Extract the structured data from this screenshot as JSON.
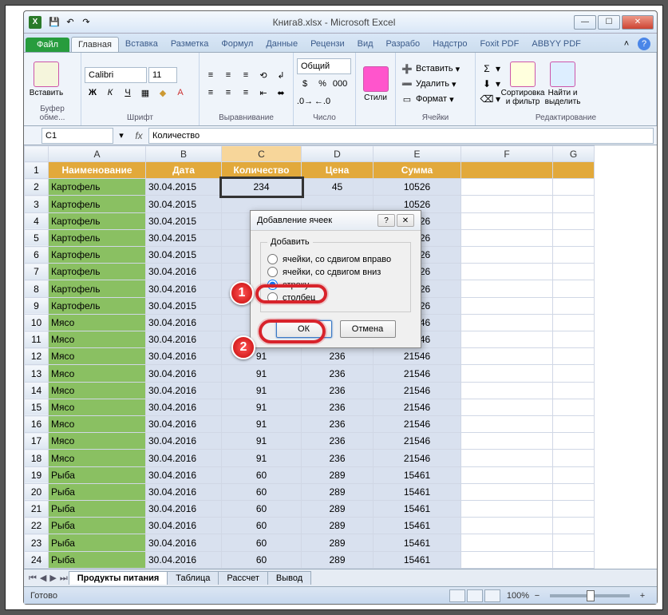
{
  "window_title": "Книга8.xlsx - Microsoft Excel",
  "tabs": {
    "file": "Файл",
    "list": [
      "Главная",
      "Вставка",
      "Разметка",
      "Формул",
      "Данные",
      "Рецензи",
      "Вид",
      "Разрабо",
      "Надстро",
      "Foxit PDF",
      "ABBYY PDF"
    ],
    "active_index": 0
  },
  "ribbon_groups": {
    "clipboard": {
      "paste": "Вставить",
      "label": "Буфер обме..."
    },
    "font": {
      "name": "Calibri",
      "size": "11",
      "label": "Шрифт"
    },
    "alignment": {
      "label": "Выравнивание"
    },
    "number": {
      "format": "Общий",
      "label": "Число"
    },
    "styles": {
      "btn": "Стили"
    },
    "cells": {
      "insert": "Вставить",
      "delete": "Удалить",
      "format": "Формат",
      "label": "Ячейки"
    },
    "editing": {
      "sort": "Сортировка\nи фильтр",
      "find": "Найти и\nвыделить",
      "label": "Редактирование"
    }
  },
  "namebox": "C1",
  "formula": "Количество",
  "columns": [
    "A",
    "B",
    "C",
    "D",
    "E",
    "F",
    "G"
  ],
  "selected_col_index": 2,
  "header_row": [
    "Наименование",
    "Дата",
    "Количество",
    "Цена",
    "Сумма"
  ],
  "rows": [
    [
      "Картофель",
      "30.04.2015",
      "234",
      "45",
      "10526"
    ],
    [
      "Картофель",
      "30.04.2015",
      "",
      "",
      "10526"
    ],
    [
      "Картофель",
      "30.04.2015",
      "",
      "",
      "10526"
    ],
    [
      "Картофель",
      "30.04.2015",
      "",
      "",
      "10526"
    ],
    [
      "Картофель",
      "30.04.2015",
      "",
      "",
      "10526"
    ],
    [
      "Картофель",
      "30.04.2016",
      "",
      "",
      "10526"
    ],
    [
      "Картофель",
      "30.04.2016",
      "",
      "",
      "10526"
    ],
    [
      "Картофель",
      "30.04.2015",
      "",
      "",
      "10526"
    ],
    [
      "Мясо",
      "30.04.2016",
      "",
      "",
      "21546"
    ],
    [
      "Мясо",
      "30.04.2016",
      "",
      "",
      "21546"
    ],
    [
      "Мясо",
      "30.04.2016",
      "91",
      "236",
      "21546"
    ],
    [
      "Мясо",
      "30.04.2016",
      "91",
      "236",
      "21546"
    ],
    [
      "Мясо",
      "30.04.2016",
      "91",
      "236",
      "21546"
    ],
    [
      "Мясо",
      "30.04.2016",
      "91",
      "236",
      "21546"
    ],
    [
      "Мясо",
      "30.04.2016",
      "91",
      "236",
      "21546"
    ],
    [
      "Мясо",
      "30.04.2016",
      "91",
      "236",
      "21546"
    ],
    [
      "Мясо",
      "30.04.2016",
      "91",
      "236",
      "21546"
    ],
    [
      "Рыба",
      "30.04.2016",
      "60",
      "289",
      "15461"
    ],
    [
      "Рыба",
      "30.04.2016",
      "60",
      "289",
      "15461"
    ],
    [
      "Рыба",
      "30.04.2016",
      "60",
      "289",
      "15461"
    ],
    [
      "Рыба",
      "30.04.2016",
      "60",
      "289",
      "15461"
    ],
    [
      "Рыба",
      "30.04.2016",
      "60",
      "289",
      "15461"
    ],
    [
      "Рыба",
      "30.04.2016",
      "60",
      "289",
      "15461"
    ]
  ],
  "sheet_tabs": [
    "Продукты питания",
    "Таблица",
    "Рассчет",
    "Вывод"
  ],
  "active_sheet_index": 0,
  "status": "Готово",
  "zoom": "100%",
  "dialog": {
    "title": "Добавление ячеек",
    "group_label": "Добавить",
    "opt1": "ячейки, со сдвигом вправо",
    "opt2": "ячейки, со сдвигом вниз",
    "opt3": "строку",
    "opt4": "столбец",
    "selected": "opt3",
    "ok": "ОК",
    "cancel": "Отмена"
  },
  "annotations": {
    "n1": "1",
    "n2": "2"
  }
}
